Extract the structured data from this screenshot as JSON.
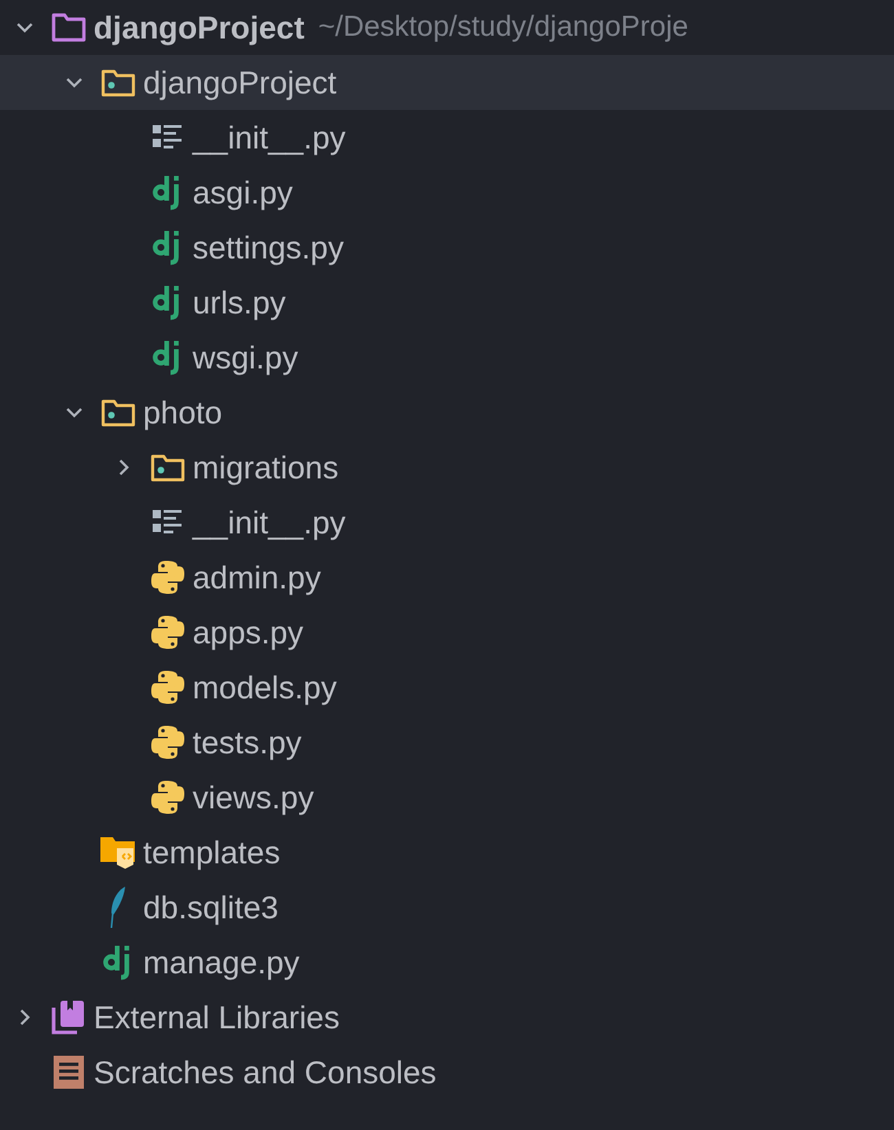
{
  "tree": [
    {
      "kind": "project",
      "label": "djangoProject",
      "path": "~/Desktop/study/djangoProje",
      "expanded": true,
      "selected": false,
      "children": [
        {
          "kind": "package",
          "label": "djangoProject",
          "expanded": true,
          "selected": true,
          "children": [
            {
              "kind": "init",
              "label": "__init__.py",
              "selected": false
            },
            {
              "kind": "django",
              "label": "asgi.py",
              "selected": false
            },
            {
              "kind": "django",
              "label": "settings.py",
              "selected": false
            },
            {
              "kind": "django",
              "label": "urls.py",
              "selected": false
            },
            {
              "kind": "django",
              "label": "wsgi.py",
              "selected": false
            }
          ]
        },
        {
          "kind": "package",
          "label": "photo",
          "expanded": true,
          "selected": false,
          "children": [
            {
              "kind": "package",
              "label": "migrations",
              "expanded": false,
              "selected": false
            },
            {
              "kind": "init",
              "label": "__init__.py",
              "selected": false
            },
            {
              "kind": "python",
              "label": "admin.py",
              "selected": false
            },
            {
              "kind": "python",
              "label": "apps.py",
              "selected": false
            },
            {
              "kind": "python",
              "label": "models.py",
              "selected": false
            },
            {
              "kind": "python",
              "label": "tests.py",
              "selected": false
            },
            {
              "kind": "python",
              "label": "views.py",
              "selected": false
            }
          ]
        },
        {
          "kind": "templates",
          "label": "templates",
          "selected": false
        },
        {
          "kind": "sqlite",
          "label": "db.sqlite3",
          "selected": false
        },
        {
          "kind": "django",
          "label": "manage.py",
          "selected": false
        }
      ]
    },
    {
      "kind": "libraries",
      "label": "External Libraries",
      "expanded": false,
      "selected": false
    },
    {
      "kind": "scratches",
      "label": "Scratches and Consoles",
      "selected": false
    }
  ]
}
